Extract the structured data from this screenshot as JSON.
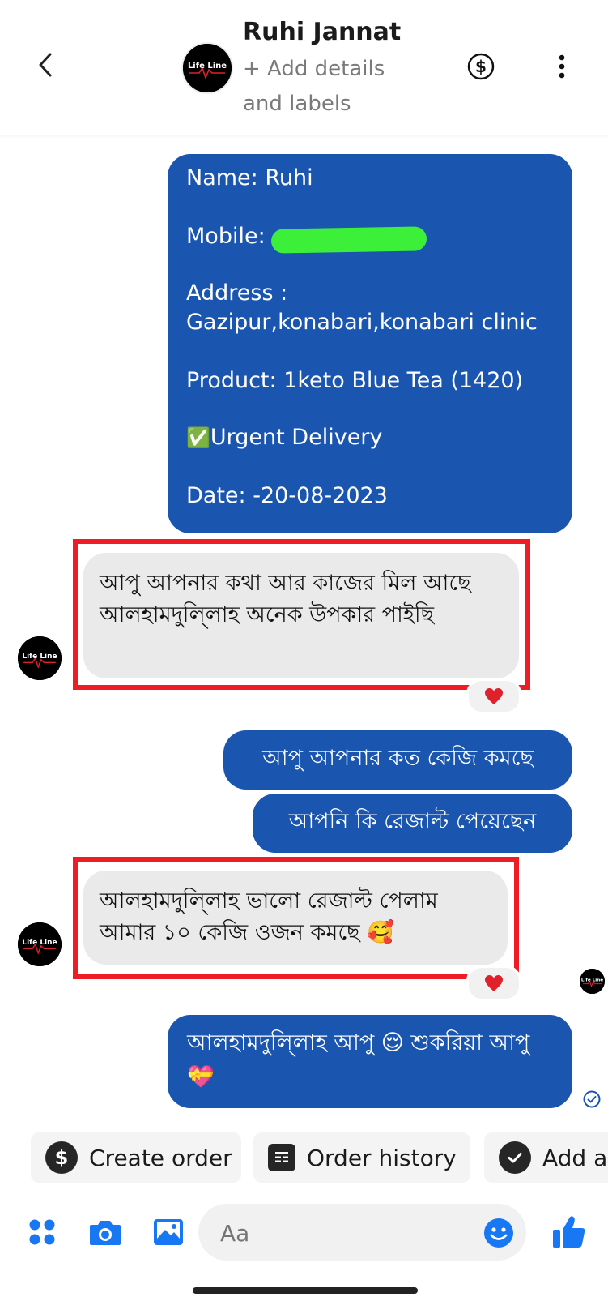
{
  "header": {
    "contact_name": "Ruhi Jannat",
    "add_details_label": "+ Add details and labels",
    "avatar_text": "Life Line"
  },
  "messages": {
    "order": {
      "name_line": "Name: Ruhi",
      "mobile_label": "Mobile:",
      "address_label": "Address :",
      "address_value": "Gazipur,konabari,konabari clinic",
      "product_line": "Product: 1keto Blue Tea (1420)",
      "delivery_check": "✅",
      "delivery_line": "Urgent Delivery",
      "date_line": "Date: -20-08-2023"
    },
    "incoming_1": "আপু আপনার কথা আর কাজের মিল আছে আলহামদুলি্লাহ অনেক উপকার পাইছি",
    "outgoing_1": "আপু আপনার কত কেজি কমছে",
    "outgoing_2": "আপনি কি রেজাল্ট পেয়েছেন",
    "incoming_2": "আলহামদুলি্লাহ ভালো রেজাল্ট পেলাম আমার ১০ কেজি ওজন কমছে 🥰",
    "outgoing_3": "আলহামদুলি্লাহ আপু 😌 শুকরিয়া আপু 💝",
    "reaction": "❤️"
  },
  "quick_actions": [
    {
      "label": "Create order",
      "icon": "dollar-icon"
    },
    {
      "label": "Order history",
      "icon": "receipt-icon"
    },
    {
      "label": "Add ac",
      "icon": "check-icon"
    }
  ],
  "composer": {
    "placeholder": "Aa"
  },
  "colors": {
    "outgoing_bubble": "#1a55b0",
    "incoming_bubble": "#eaeaea",
    "accent": "#1877f2",
    "highlight_frame": "#ee1c24",
    "redaction": "#3cf03a"
  }
}
